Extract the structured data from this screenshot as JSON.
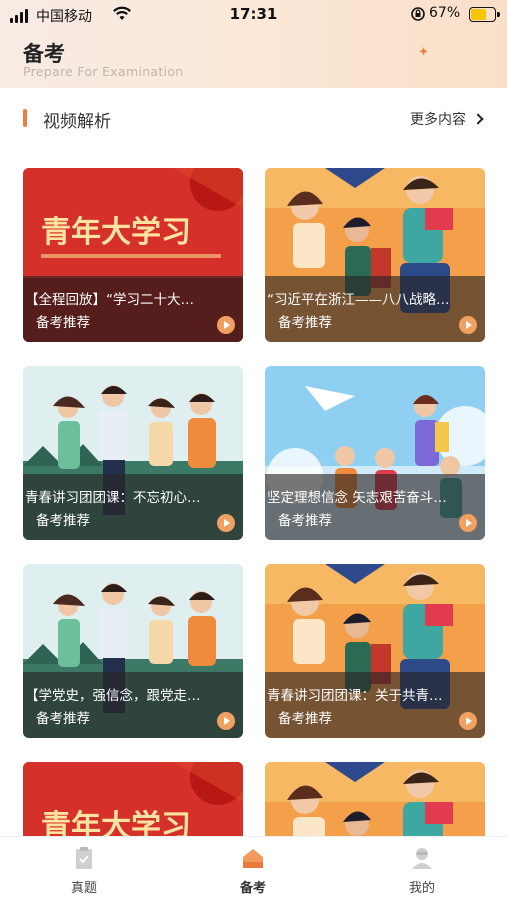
{
  "status_bar": {
    "carrier": "中国移动",
    "time": "17:31",
    "battery": "67%",
    "battery_level": 0.67
  },
  "header": {
    "title": "备考",
    "subtitle": "Prepare For Examination"
  },
  "section": {
    "title": "视频解析",
    "more_label": "更多内容"
  },
  "cards": [
    {
      "title": "【全程回放】“学习二十大…",
      "subtitle": "备考推荐",
      "art": "red-banner",
      "banner_text": "青年大学习"
    },
    {
      "title": "“习近平在浙江——八八战略…",
      "subtitle": "备考推荐",
      "art": "orange-students"
    },
    {
      "title": "青春讲习团团课：不忘初心…",
      "subtitle": "备考推荐",
      "art": "green-youth"
    },
    {
      "title": "坚定理想信念 矢志艰苦奋斗…",
      "subtitle": "备考推荐",
      "art": "sky-plane"
    },
    {
      "title": "【学党史，强信念，跟党走…",
      "subtitle": "备考推荐",
      "art": "green-youth"
    },
    {
      "title": "青春讲习团团课：关于共青…",
      "subtitle": "备考推荐",
      "art": "orange-students"
    },
    {
      "title": "",
      "subtitle": "",
      "art": "red-banner",
      "banner_text": "青年大学习"
    },
    {
      "title": "",
      "subtitle": "",
      "art": "orange-students"
    }
  ],
  "tabs": [
    {
      "label": "真题",
      "icon": "clipboard-check-icon",
      "active": false
    },
    {
      "label": "备考",
      "icon": "house-icon",
      "active": true
    },
    {
      "label": "我的",
      "icon": "person-icon",
      "active": false
    }
  ],
  "colors": {
    "accent": "#f07d3a",
    "header_bg": "#fbe9da",
    "caption_overlay": "#282424"
  }
}
